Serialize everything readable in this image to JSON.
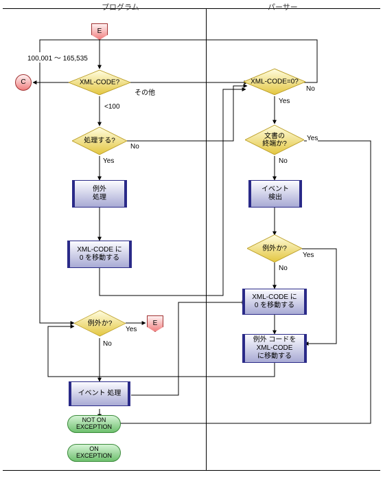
{
  "headers": {
    "left": "プログラム",
    "right": "パーサー"
  },
  "labels": {
    "range": "100,001 ～ 165,535",
    "xmlcode_q": "XML-CODE?",
    "other": "その他",
    "lt100": "<100",
    "process_q": "処理する?",
    "yes": "Yes",
    "no": "No",
    "exc_handling": "例外\n処理",
    "move_zero": "XML-CODE に\n0 を移動する",
    "xmlcode_eq0": "XML-CODE=0?",
    "end_of_doc": "文書の\n終端か?",
    "event_detect": "イベント\n検出",
    "is_exc": "例外か?",
    "move_zero2": "XML-CODE に\n0 を移動する",
    "move_exc_code": "例外 コードを\nXML-CODE\nに移動する",
    "is_exc2": "例外か?",
    "event_proc": "イベント 処理",
    "not_on_exc": "NOT ON\nEXCEPTION",
    "on_exc": "ON\nEXCEPTION",
    "tag_c": "C",
    "tag_e": "E"
  }
}
